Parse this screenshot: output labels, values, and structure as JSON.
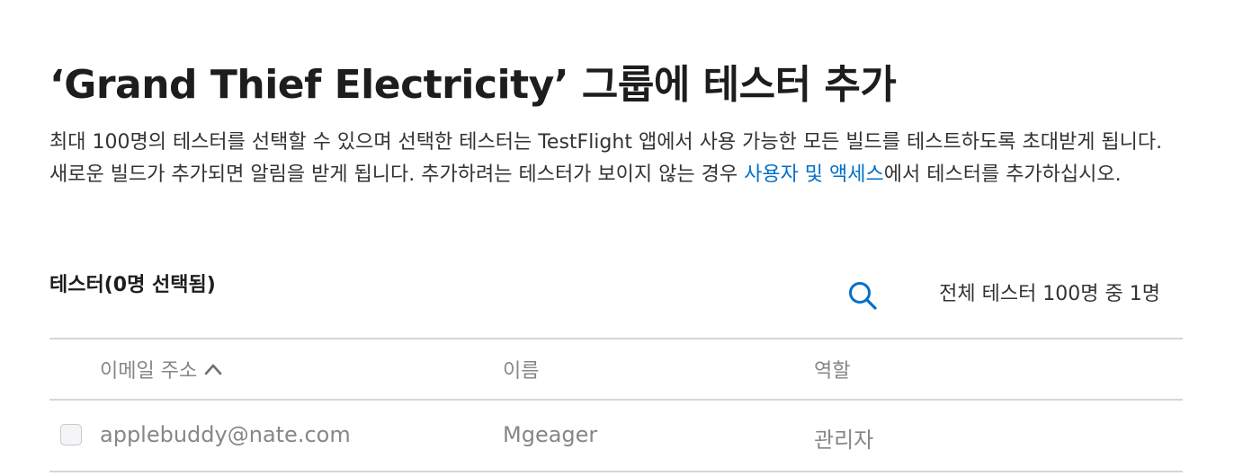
{
  "title": "‘Grand Thief Electricity’ 그룹에 테스터 추가",
  "description": {
    "text_before_link": "최대 100명의 테스터를 선택할 수 있으며 선택한 테스터는 TestFlight 앱에서 사용 가능한 모든 빌드를 테스트하도록 초대받게 됩니다. 새로운 빌드가 추가되면 알림을 받게 됩니다. 추가하려는 테스터가 보이지 않는 경우 ",
    "link_text": "사용자 및 액세스",
    "text_after_link": "에서 테스터를 추가하십시오."
  },
  "testers_section": {
    "label": "테스터(0명 선택됨)",
    "search_icon": "search-icon",
    "count_text": "전체 테스터 100명 중 1명"
  },
  "table": {
    "columns": {
      "email": "이메일 주소",
      "name": "이름",
      "role": "역할"
    },
    "sort_icon": "chevron-up-icon",
    "rows": [
      {
        "email": "applebuddy@nate.com",
        "name": "Mgeager",
        "role": "관리자",
        "checked": false
      }
    ]
  },
  "colors": {
    "link": "#0070c9",
    "muted_text": "#86868b",
    "divider": "#d6d6d6"
  }
}
